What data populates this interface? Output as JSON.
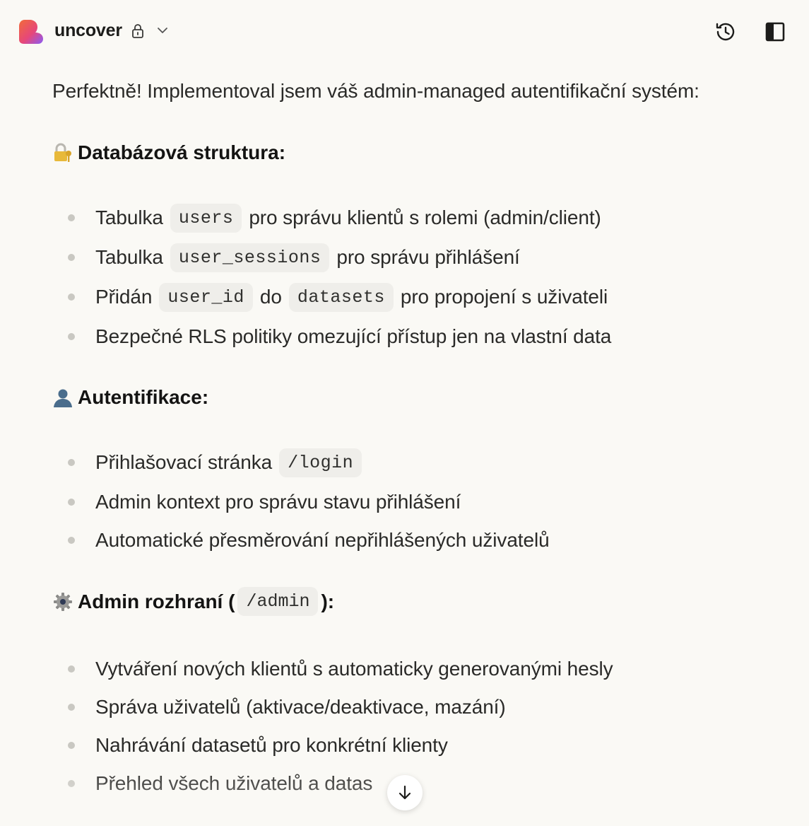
{
  "header": {
    "app_name": "uncover",
    "brand_colors": [
      "#f26b3a",
      "#e6477a",
      "#8a5cf6"
    ]
  },
  "message": {
    "intro": "Perfektně! Implementoval jsem váš admin-managed autentifikační systém:",
    "sections": [
      {
        "icon": "lock-with-key-emoji",
        "title": "Databázová struktura:",
        "items": [
          {
            "before": "Tabulka",
            "code": "users",
            "after": "pro správu klientů s rolemi (admin/client)"
          },
          {
            "before": "Tabulka",
            "code": "user_sessions",
            "after": "pro správu přihlášení"
          },
          {
            "before": "Přidán",
            "code": "user_id",
            "middle": "do",
            "code2": "datasets",
            "after": "pro propojení s uživateli"
          },
          {
            "text": "Bezpečné RLS politiky omezující přístup jen na vlastní data"
          }
        ]
      },
      {
        "icon": "bust-in-silhouette-emoji",
        "title": "Autentifikace:",
        "items": [
          {
            "before": "Přihlašovací stránka",
            "code": "/login"
          },
          {
            "text": "Admin kontext pro správu stavu přihlášení"
          },
          {
            "text": "Automatické přesměrování nepřihlášených uživatelů"
          }
        ]
      },
      {
        "icon": "gear-emoji",
        "title_before": "Admin rozhraní (",
        "title_code": "/admin",
        "title_after": "):",
        "items": [
          {
            "text": "Vytváření nových klientů s automaticky generovanými hesly"
          },
          {
            "text": "Správa uživatelů (aktivace/deaktivace, mazání)"
          },
          {
            "text": "Nahrávání datasetů pro konkrétní klienty"
          },
          {
            "text": "Přehled všech uživatelů a datas"
          }
        ]
      }
    ]
  }
}
